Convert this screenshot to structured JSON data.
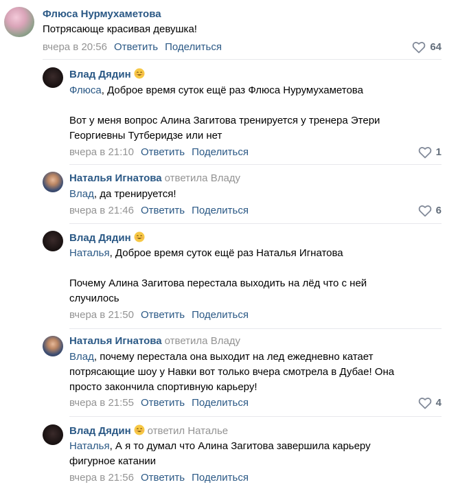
{
  "comments": [
    {
      "author": "Флюса Нурмухаметова",
      "text_lines": [
        "Потрясающе красивая девушка!"
      ],
      "time": "вчера в 20:56",
      "reply": "Ответить",
      "share": "Поделиться",
      "likes": "64"
    },
    {
      "author": "Влад Дядин",
      "mention": "Флюса",
      "line1_rest": ", Доброе время суток ещё раз Флюса Нурумухаметова",
      "line2": "Вот у меня вопрос Алина Загитова тренируется у тренера Этери",
      "line3": "Георгиевны Тутберидзе или нет",
      "time": "вчера в 21:10",
      "reply": "Ответить",
      "share": "Поделиться",
      "likes": "1"
    },
    {
      "author": "Наталья Игнатова",
      "replied_to": "ответила Владу",
      "mention": "Влад",
      "line1_rest": ", да тренируется!",
      "time": "вчера в 21:46",
      "reply": "Ответить",
      "share": "Поделиться",
      "likes": "6"
    },
    {
      "author": "Влад Дядин",
      "mention": "Наталья",
      "line1_rest": ", Доброе время суток ещё раз Наталья Игнатова",
      "line2": "Почему Алина Загитова перестала выходить на лёд что с ней",
      "line3": "случилось",
      "time": "вчера в 21:50",
      "reply": "Ответить",
      "share": "Поделиться"
    },
    {
      "author": "Наталья Игнатова",
      "replied_to": "ответила Владу",
      "mention": "Влад",
      "line1_rest": ", почему перестала она выходит на лед ежедневно катает",
      "line2": "потрясающие шоу у Навки вот только вчера смотрела в Дубае! Она",
      "line3": "просто закончила спортивную карьеру!",
      "time": "вчера в 21:55",
      "reply": "Ответить",
      "share": "Поделиться",
      "likes": "4"
    },
    {
      "author": "Влад Дядин",
      "replied_to": "ответил Наталье",
      "mention": "Наталья",
      "line1_rest": ", А я то думал что Алина Загитова завершила карьеру",
      "line2": "фигурное катании",
      "time": "вчера в 21:56",
      "reply": "Ответить",
      "share": "Поделиться"
    }
  ],
  "icons": {
    "like": "heart-outline-icon",
    "emoji": "smiling-face-icon"
  },
  "colors": {
    "link": "#2a5885",
    "meta": "#939393",
    "divider": "#e7e8ec"
  }
}
